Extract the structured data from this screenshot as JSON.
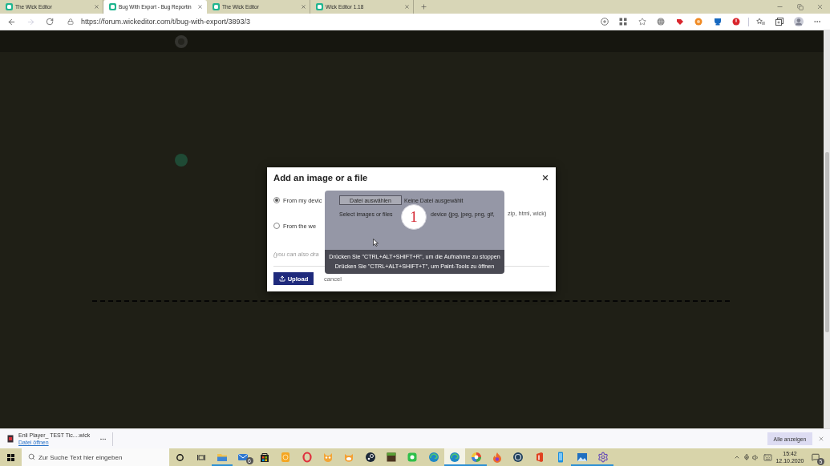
{
  "browser": {
    "tabs": [
      {
        "title": "The Wick Editor",
        "selected": false
      },
      {
        "title": "Bug With Export - Bug Reportin",
        "selected": true
      },
      {
        "title": "The Wick Editor",
        "selected": false
      },
      {
        "title": "Wick Editor 1.18",
        "selected": false
      }
    ],
    "navigation": [
      {
        "kind": "back",
        "disabled": false
      },
      {
        "kind": "forward",
        "disabled": true
      },
      {
        "kind": "reload",
        "disabled": false
      }
    ],
    "address": "https://forum.wickeditor.com/t/bug-with-export/3893/3"
  },
  "dialog": {
    "title": "Add an image or a file",
    "sources": [
      {
        "label": "From my devic",
        "selected": true
      },
      {
        "label": "From the we",
        "selected": false
      }
    ],
    "file_types_end": "zip, html, wick)",
    "drop_hint": "(you can also dra",
    "upload": "Upload",
    "cancel": "cancel"
  },
  "recorder_overlay": {
    "file_button": "Datei auswählen",
    "file_status": "Keine Datei ausgewählt",
    "file_hint": "Select images or files",
    "file_types": "device (jpg, jpeg, png, gif,",
    "countdown": "1",
    "shortcuts": [
      "Drücken Sie \"CTRL+ALT+SHIFT+R\", um die Aufnahme zu stoppen",
      "Drücken Sie \"CTRL+ALT+SHIFT+T\", um Paint-Tools zu öffnen"
    ]
  },
  "download_bar": {
    "file_name": "Enli Player_ TEST Tic....wick",
    "open_link": "Datei öffnen",
    "show_all": "Alle anzeigen"
  },
  "taskbar": {
    "search_placeholder": "Zur Suche Text hier eingeben",
    "apps": [
      {
        "kind": "folder",
        "running": true,
        "selected": false
      },
      {
        "kind": "mail",
        "running": false,
        "selected": false,
        "badge": "6"
      },
      {
        "kind": "bag",
        "running": false,
        "selected": false
      },
      {
        "kind": "tile",
        "running": false,
        "selected": false
      },
      {
        "kind": "ring",
        "running": false,
        "selected": false
      },
      {
        "kind": "cat",
        "running": false,
        "selected": false
      },
      {
        "kind": "cat_face",
        "running": false,
        "selected": false
      },
      {
        "kind": "disc",
        "running": false,
        "selected": false
      },
      {
        "kind": "block",
        "running": false,
        "selected": false
      },
      {
        "kind": "square",
        "running": false,
        "selected": false
      },
      {
        "kind": "swirl",
        "running": false,
        "selected": false
      },
      {
        "kind": "swirl",
        "running": true,
        "selected": true
      },
      {
        "kind": "ball",
        "running": true,
        "selected": false
      },
      {
        "kind": "flame",
        "running": false,
        "selected": false
      },
      {
        "kind": "dial",
        "running": false,
        "selected": false
      },
      {
        "kind": "door",
        "running": false,
        "selected": false
      },
      {
        "kind": "phone",
        "running": false,
        "selected": false
      },
      {
        "kind": "picture",
        "running": true,
        "selected": false
      },
      {
        "kind": "gear",
        "running": true,
        "selected": false
      }
    ],
    "clock": {
      "time": "15:42",
      "date": "12.10.2020"
    },
    "notifications": "5"
  }
}
